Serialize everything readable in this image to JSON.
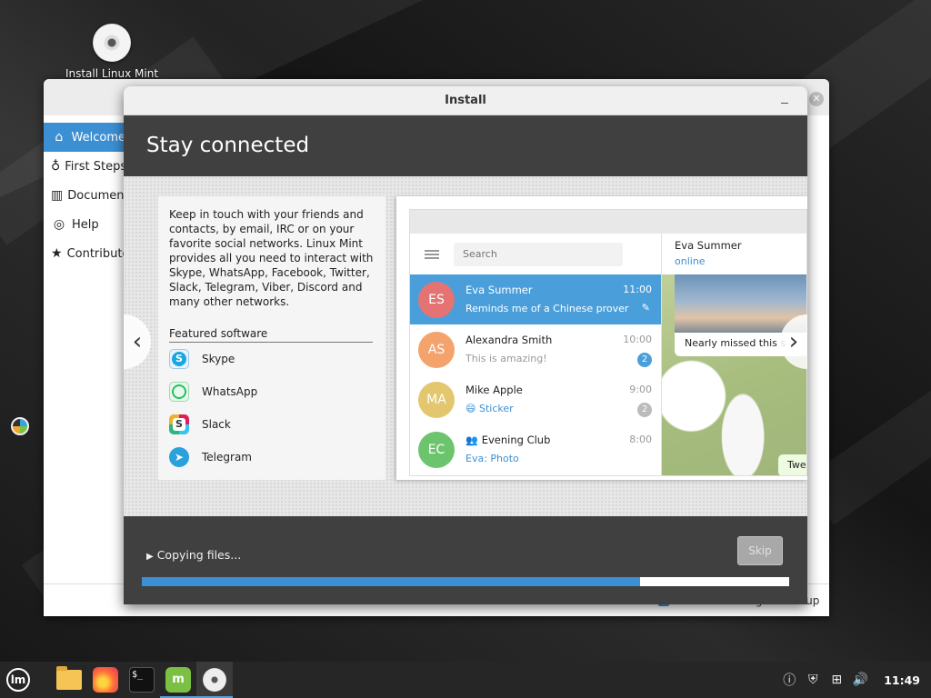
{
  "desktop": {
    "icons": [
      {
        "label": "Install Linux Mint",
        "icon": "disc-icon"
      }
    ]
  },
  "welcome": {
    "sidebar": [
      {
        "label": "Welcome",
        "icon": "home-icon"
      },
      {
        "label": "First Steps",
        "icon": "lightbulb-icon"
      },
      {
        "label": "Documentation",
        "icon": "book-icon"
      },
      {
        "label": "Help",
        "icon": "lifebuoy-icon"
      },
      {
        "label": "Contribute",
        "icon": "star-icon"
      }
    ],
    "footer_checkbox_label": "Show this dialog at startup"
  },
  "installer": {
    "window_title": "Install",
    "slide_title": "Stay connected",
    "description": "Keep in touch with your friends and contacts, by email, IRC or on your favorite social networks. Linux Mint provides all you need to interact with Skype, WhatsApp, Facebook, Twitter, Slack, Telegram, Viber, Discord and many other networks.",
    "featured_title": "Featured software",
    "featured_apps": [
      {
        "name": "Skype",
        "icon": "skype-icon"
      },
      {
        "name": "WhatsApp",
        "icon": "whatsapp-icon"
      },
      {
        "name": "Slack",
        "icon": "slack-icon"
      },
      {
        "name": "Telegram",
        "icon": "telegram-icon"
      }
    ],
    "screenshot": {
      "search_placeholder": "Search",
      "chats": [
        {
          "initials": "ES",
          "name": "Eva Summer",
          "time": "11:00",
          "preview": "Reminds me of a Chinese prover…",
          "color": "#e57373",
          "pinned": true
        },
        {
          "initials": "AS",
          "name": "Alexandra Smith",
          "time": "10:00",
          "preview": "This is amazing!",
          "color": "#f5a36c",
          "badge": "2"
        },
        {
          "initials": "MA",
          "name": "Mike Apple",
          "time": "9:00",
          "preview": "😄 Sticker",
          "color": "#e2c76e",
          "badge": "2"
        },
        {
          "initials": "EC",
          "name": "Evening Club",
          "time": "8:00",
          "preview": "Eva: Photo",
          "color": "#6cc46c"
        }
      ],
      "active_chat_name": "Eva Summer",
      "active_chat_status": "online",
      "photo_caption": "Nearly missed this s",
      "small_bubble": "Twe"
    },
    "progress_label": "Copying files...",
    "progress_fraction": 0.77,
    "skip_label": "Skip"
  },
  "taskbar": {
    "apps": [
      "mint-menu-icon",
      "files-icon",
      "firefox-icon",
      "terminal-icon",
      "software-manager-icon",
      "installer-disc-icon"
    ],
    "menu_glyph": "lm",
    "terminal_glyph": "$_",
    "clock": "11:49"
  },
  "colors": {
    "accent": "#3d8fd3",
    "mint_green": "#7bc043",
    "header": "#404040"
  }
}
